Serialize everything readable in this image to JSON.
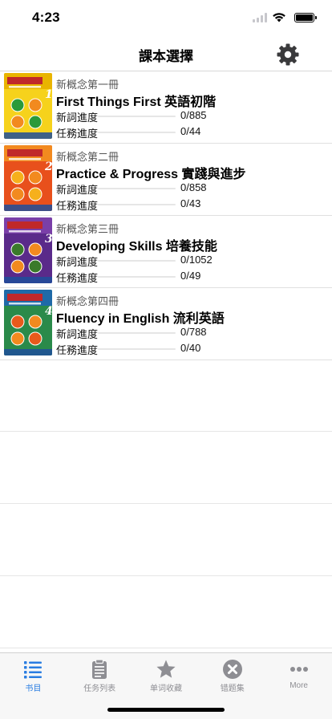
{
  "status_bar": {
    "time": "4:23"
  },
  "nav": {
    "title": "課本選擇",
    "settings_icon": "gear-icon"
  },
  "colors": {
    "accent": "#2a7de1",
    "progress": "#2f8cf5",
    "tab_inactive": "#8e8e93"
  },
  "books": [
    {
      "series": "新概念第一冊",
      "title": "First Things First 英語初階",
      "words_label": "新詞進度",
      "words_value": "0/885",
      "words_progress": 0,
      "tasks_label": "任務進度",
      "tasks_value": "0/44",
      "tasks_progress": 0,
      "cover": {
        "number": "1",
        "colors": [
          "#f6d21c",
          "#e9b400",
          "#2a9a3a"
        ]
      }
    },
    {
      "series": "新概念第二冊",
      "title": "Practice & Progress 實踐與進步",
      "words_label": "新詞進度",
      "words_value": "0/858",
      "words_progress": 0,
      "tasks_label": "任務進度",
      "tasks_value": "0/43",
      "tasks_progress": 0,
      "cover": {
        "number": "2",
        "colors": [
          "#e8501c",
          "#f28a1f",
          "#f6b01c"
        ]
      }
    },
    {
      "series": "新概念第三冊",
      "title": "Developing Skills 培養技能",
      "words_label": "新詞進度",
      "words_value": "0/1052",
      "words_progress": 0,
      "tasks_label": "任務進度",
      "tasks_value": "0/49",
      "tasks_progress": 0,
      "cover": {
        "number": "3",
        "colors": [
          "#5a2a8a",
          "#7a3fa8",
          "#3a7a2a"
        ]
      }
    },
    {
      "series": "新概念第四冊",
      "title": "Fluency in English 流利英語",
      "words_label": "新詞進度",
      "words_value": "0/788",
      "words_progress": 0,
      "tasks_label": "任務進度",
      "tasks_value": "0/40",
      "tasks_progress": 0,
      "cover": {
        "number": "4",
        "colors": [
          "#2a8a4a",
          "#1f6aa8",
          "#e85a1c"
        ]
      }
    }
  ],
  "tabs": [
    {
      "label": "书目",
      "icon": "list-icon",
      "active": true
    },
    {
      "label": "任务列表",
      "icon": "clipboard-icon",
      "active": false
    },
    {
      "label": "单词收藏",
      "icon": "star-icon",
      "active": false
    },
    {
      "label": "错题集",
      "icon": "close-circle-icon",
      "active": false
    },
    {
      "label": "More",
      "icon": "more-icon",
      "active": false
    }
  ]
}
